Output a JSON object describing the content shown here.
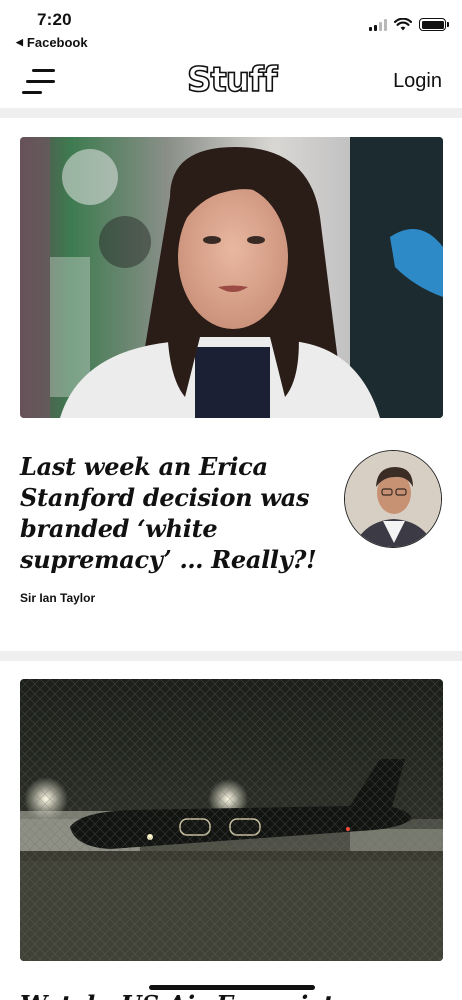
{
  "status_bar": {
    "time": "7:20",
    "back_label": "Facebook",
    "icons": [
      "cellular-signal-icon",
      "wifi-icon",
      "battery-icon"
    ]
  },
  "nav": {
    "logo": "Stuff",
    "login_label": "Login",
    "menu_icon": "hamburger-menu-icon"
  },
  "articles": [
    {
      "image": "woman-speaking-photo",
      "headline_lines": [
        "Last week an Erica",
        "Stanford decision was",
        "branded ‘white",
        "supremacy’ … Really?!"
      ],
      "byline": "Sir Ian Taylor",
      "author_image": "author-portrait-photo"
    },
    {
      "image": "military-aircraft-night-photo",
      "headline_peek": "Watch: US Air Force jet"
    }
  ],
  "colors": {
    "background": "#ffffff",
    "divider": "#efefef",
    "text": "#111111"
  }
}
